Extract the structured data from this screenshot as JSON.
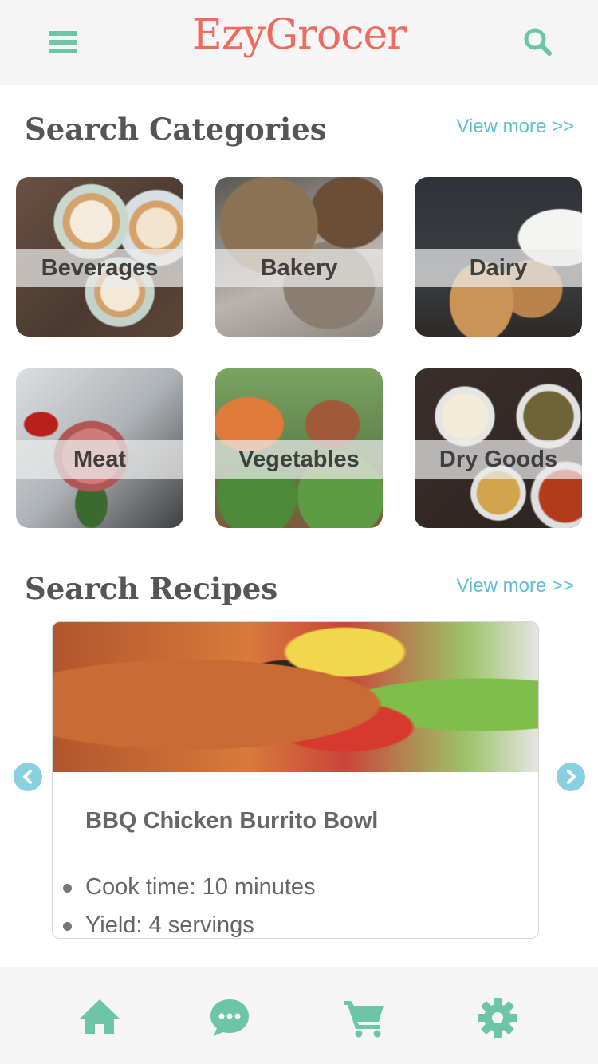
{
  "app": {
    "title": "EzyGrocer"
  },
  "colors": {
    "brand": "#ef6b60",
    "accent": "#6cc5a6",
    "link": "#5ebfcf",
    "arrow": "#88d0e0"
  },
  "header": {
    "menu_icon": "hamburger-menu-icon",
    "search_icon": "search-icon"
  },
  "categories": {
    "title": "Search Categories",
    "view_more": "View more >>",
    "items": [
      {
        "label": "Beverages"
      },
      {
        "label": "Bakery"
      },
      {
        "label": "Dairy"
      },
      {
        "label": "Meat"
      },
      {
        "label": "Vegetables"
      },
      {
        "label": "Dry Goods"
      }
    ]
  },
  "recipes": {
    "title": "Search Recipes",
    "view_more": "View more >>",
    "current": {
      "name": "BBQ Chicken Burrito Bowl",
      "facts": [
        "Cook time: 10 minutes",
        "Yield: 4 servings"
      ]
    },
    "prev_icon": "chevron-left-icon",
    "next_icon": "chevron-right-icon"
  },
  "bottom_nav": {
    "items": [
      {
        "icon": "home-icon"
      },
      {
        "icon": "chat-icon"
      },
      {
        "icon": "cart-icon"
      },
      {
        "icon": "settings-gear-icon"
      }
    ]
  }
}
